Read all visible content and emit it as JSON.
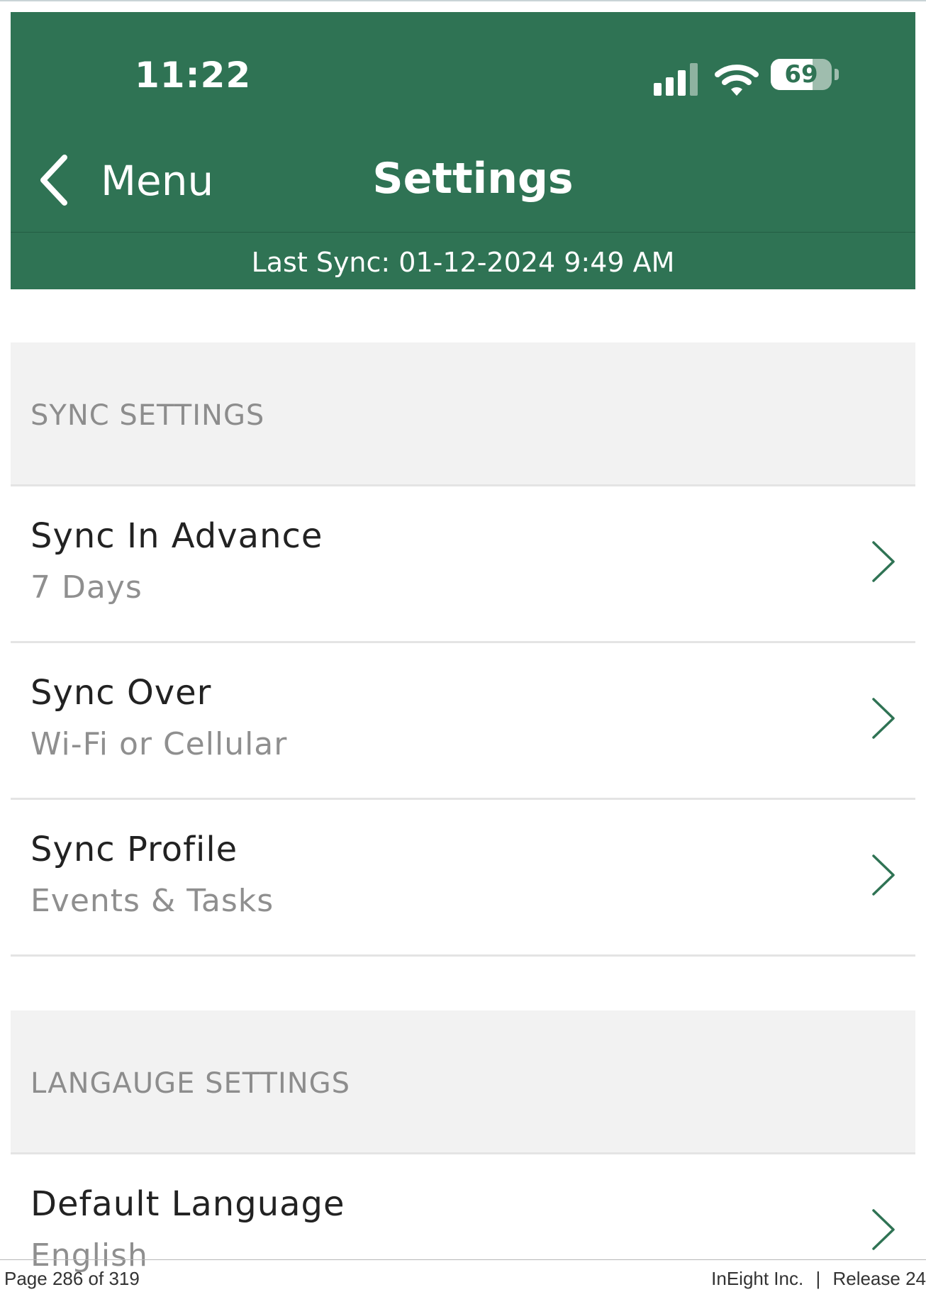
{
  "status_bar": {
    "time": "11:22",
    "battery_level": "69",
    "battery_fraction": 0.69,
    "signal_icon": "cellular-signal-icon",
    "wifi_icon": "wifi-icon",
    "battery_icon": "battery-icon"
  },
  "nav": {
    "back_label": "Menu",
    "back_icon": "chevron-left-icon",
    "title": "Settings",
    "last_sync": "Last Sync: 01-12-2024 9:49 AM"
  },
  "sections": {
    "sync": {
      "title": "SYNC SETTINGS",
      "items": [
        {
          "label": "Sync In Advance",
          "value": "7 Days"
        },
        {
          "label": "Sync Over",
          "value": "Wi-Fi or Cellular"
        },
        {
          "label": "Sync Profile",
          "value": "Events & Tasks"
        }
      ]
    },
    "language": {
      "title": "LANGAUGE SETTINGS",
      "items": [
        {
          "label": "Default Language",
          "value": "English"
        }
      ]
    }
  },
  "footer": {
    "page": "Page 286 of 319",
    "company": "InEight Inc.",
    "separator": "|",
    "release": "Release 24"
  },
  "colors": {
    "header_green": "#2f7354",
    "chevron_green": "#2f7354",
    "section_background": "#f2f2f2",
    "section_text": "#8d8d8d",
    "value_text": "#8f8f8f"
  }
}
